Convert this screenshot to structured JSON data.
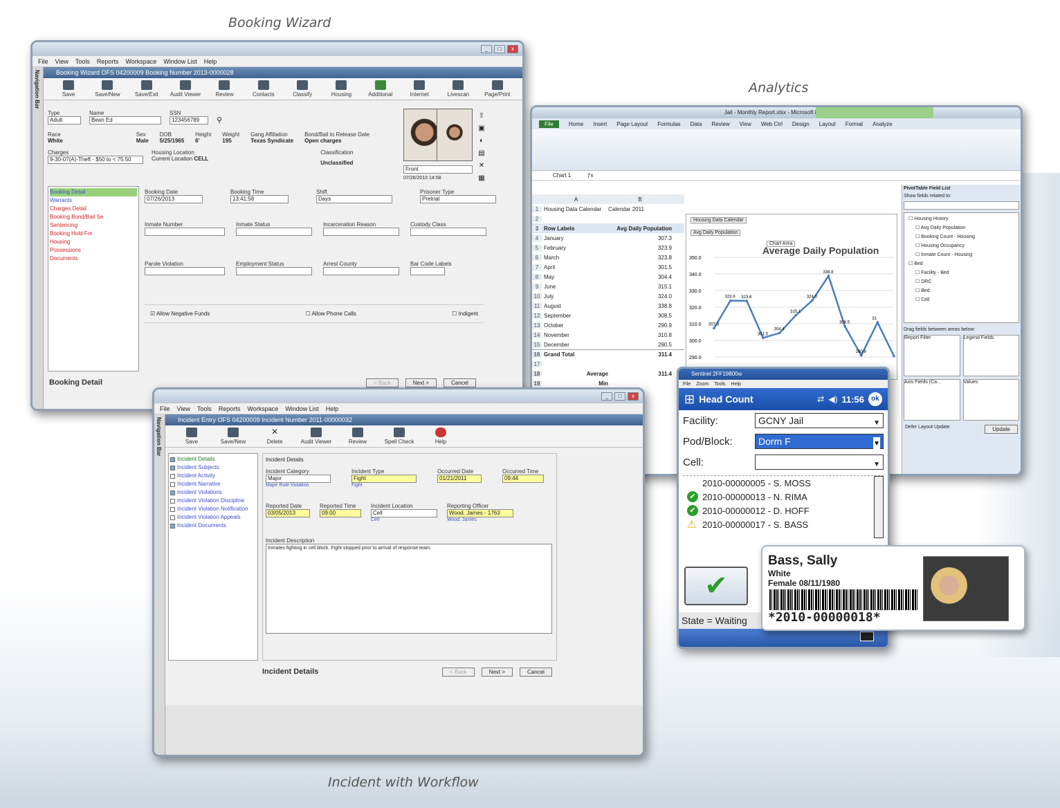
{
  "captions": {
    "booking": "Booking Wizard",
    "analytics": "Analytics",
    "incident": "Incident with Workflow"
  },
  "booking": {
    "menu": [
      "File",
      "View",
      "Tools",
      "Reports",
      "Workspace",
      "Window List",
      "Help"
    ],
    "title": "Booking Wizard   OFS 04200009   Booking Number 2013-0000028",
    "toolbar": [
      "Save",
      "Save/New",
      "Save/Exit",
      "Audit Viewer",
      "Review",
      "Contacts",
      "Classify",
      "Housing",
      "Additional",
      "Internet",
      "Livescan",
      "Page/Print"
    ],
    "labels": {
      "type": "Type",
      "name": "Name",
      "ssn": "SSN",
      "race": "Race",
      "sex": "Sex",
      "dob": "DOB",
      "height": "Height",
      "weight": "Weight",
      "gang": "Gang Affiliation",
      "bond": "Bond/Bail to Release Date",
      "charges": "Charges",
      "housing_location": "Housing Location",
      "current_location": "Current Location",
      "classification": "Classification",
      "booking_date": "Booking Date",
      "booking_time": "Booking Time",
      "shift": "Shift",
      "prisoner_type": "Prisoner Type",
      "inmate_number": "Inmate Number",
      "inmate_status": "Inmate Status",
      "incarceration_reason": "Incarceration Reason",
      "custody_class": "Custody Class",
      "parole_violation": "Parole Violation",
      "employment_status": "Employment Status",
      "arrest_county": "Arrest County",
      "bar_code_labels": "Bar Code Labels"
    },
    "values": {
      "type": "Adult",
      "name": "Bean Ed",
      "ssn": "123456789",
      "race": "White",
      "sex": "Male",
      "dob": "5/25/1965",
      "height": "6'",
      "weight": "195",
      "gang": "Texas Syndicate",
      "bond": "Open charges",
      "charges": "9-30-07(A)-Theft - $50 to < 75.50",
      "current_location": "CELL",
      "classification": "Unclassified",
      "photo_field": "Front",
      "photo_date": "07/26/2013 14:58",
      "booking_date": "07/26/2013",
      "booking_time": "13:41:58",
      "shift": "Days",
      "prisoner_type": "Pretrial"
    },
    "tree": [
      {
        "label": "Booking Detail",
        "color": "#1a7d1a"
      },
      {
        "label": "Warrants",
        "color": "#3b4fc9"
      },
      {
        "label": "Charges Detail",
        "color": "#d02020"
      },
      {
        "label": "Booking Bond/Bail Se",
        "color": "#d02020"
      },
      {
        "label": "Sentencing",
        "color": "#d02020"
      },
      {
        "label": "Booking Hold For",
        "color": "#d02020"
      },
      {
        "label": "Housing",
        "color": "#d02020"
      },
      {
        "label": "Possessions",
        "color": "#d02020"
      },
      {
        "label": "Documents",
        "color": "#d02020"
      }
    ],
    "checks": [
      "Allow Negative Funds",
      "Allow Phone Calls",
      "Indigent"
    ],
    "status": "Booking Detail",
    "buttons": [
      "< Back",
      "Next >",
      "Cancel"
    ]
  },
  "excel": {
    "title": "Jail - Monthly Report.xlsx - Microsoft Excel",
    "tabs": [
      "File",
      "Home",
      "Insert",
      "Page Layout",
      "Formulas",
      "Data",
      "Review",
      "View",
      "Web Ctrl",
      "Design",
      "Layout",
      "Format",
      "Analyze"
    ],
    "name_box": "Chart 1",
    "header_row": [
      "Housing Data Calendar",
      "Calendar 2011"
    ],
    "col_headers": [
      "Row Labels",
      "Avg Daily Population"
    ],
    "rows": [
      {
        "label": "January",
        "value": "307.3"
      },
      {
        "label": "February",
        "value": "323.9"
      },
      {
        "label": "March",
        "value": "323.8"
      },
      {
        "label": "April",
        "value": "301.5"
      },
      {
        "label": "May",
        "value": "304.4"
      },
      {
        "label": "June",
        "value": "315.1"
      },
      {
        "label": "July",
        "value": "324.0"
      },
      {
        "label": "August",
        "value": "338.8"
      },
      {
        "label": "September",
        "value": "308.5"
      },
      {
        "label": "October",
        "value": "290.9"
      },
      {
        "label": "November",
        "value": "310.8"
      },
      {
        "label": "December",
        "value": "290.5"
      },
      {
        "label": "Grand Total",
        "value": "311.4"
      }
    ],
    "summary": [
      {
        "label": "Average",
        "value": "311.4"
      },
      {
        "label": "Min",
        "value": ""
      },
      {
        "label": "Max",
        "value": ""
      }
    ],
    "pane": {
      "title": "PivotTable Field List",
      "choose": "Show fields related to:",
      "fields": [
        "Housing History",
        "Avg Daily Population",
        "Booking Count - Housing",
        "Housing Occupancy",
        "Inmate Count - Housing",
        "Bed",
        "Facility - Bed",
        "DRC",
        "Bed",
        "Cell"
      ],
      "drag": "Drag fields between areas below:",
      "areas": [
        "Report Filter",
        "Legend Fields",
        "Axis Fields (Ca...",
        "Values"
      ],
      "defer": "Defer Layout Update",
      "update": "Update"
    }
  },
  "chart_data": {
    "type": "line",
    "title": "Average Daily Population",
    "categories": [
      "January",
      "February",
      "March",
      "April",
      "May",
      "June",
      "July",
      "August",
      "September",
      "October",
      "November",
      "December"
    ],
    "values": [
      307.3,
      323.9,
      323.8,
      301.5,
      304.4,
      315.1,
      324.0,
      338.8,
      308.5,
      290.9,
      310.8,
      290.5
    ],
    "ylim": [
      280,
      350
    ],
    "yticks": [
      "350.0",
      "340.0",
      "330.0",
      "320.0",
      "310.0",
      "300.0",
      "290.0"
    ],
    "data_labels": [
      "307.3",
      "323.9",
      "323.8",
      "301.5",
      "304.4",
      "315.1",
      "324.0",
      "338.8",
      "308.5",
      "290.9",
      "31"
    ],
    "filter_button": "Housing Data Calendar",
    "series_button": "Avg Daily Population",
    "chart_area_tip": "Chart Area",
    "color": "#4a7eb8"
  },
  "mobile": {
    "title": "Sentinel 2FF19800w",
    "menu": [
      "File",
      "Zoom",
      "Tools",
      "Help"
    ],
    "header": "Head Count",
    "time": "11:56",
    "ok": "ok",
    "fields": [
      {
        "label": "Facility:",
        "value": "GCNY Jail"
      },
      {
        "label": "Pod/Block:",
        "value": "Dorm F"
      },
      {
        "label": "Cell:",
        "value": ""
      }
    ],
    "list": [
      {
        "text": "2010-00000005 - S. MOSS",
        "status": ""
      },
      {
        "text": "2010-00000013 - N. RIMA",
        "status": "ok"
      },
      {
        "text": "2010-00000012 - D. HOFF",
        "status": "ok"
      },
      {
        "text": "2010-00000017 - S. BASS",
        "status": "warn"
      }
    ],
    "state": "State = Waiting"
  },
  "idcard": {
    "name": "Bass, Sally",
    "race": "White",
    "sex_dob": "Female 08/11/1980",
    "barcode": "*2010-00000018*"
  },
  "incident": {
    "menu": [
      "File",
      "View",
      "Tools",
      "Reports",
      "Workspace",
      "Window List",
      "Help"
    ],
    "title": "Incident Entry   OFS 04200009   Incident Number 2011-00000032",
    "toolbar": [
      "Save",
      "Save/New",
      "Delete",
      "Audit Viewer",
      "Review",
      "Spell Check",
      "Help"
    ],
    "tree": [
      {
        "label": "Incident Details",
        "color": "#1a7d1a",
        "checked": true
      },
      {
        "label": "Incident Subjects",
        "color": "#3b4fc9",
        "checked": true
      },
      {
        "label": "Incident Activity",
        "color": "#3b4fc9",
        "checked": false
      },
      {
        "label": "Incident Narrative",
        "color": "#3b4fc9",
        "checked": false
      },
      {
        "label": "Incident Violations",
        "color": "#3b4fc9",
        "checked": true
      },
      {
        "label": "Incident Violation Discipline",
        "color": "#3b4fc9",
        "checked": false
      },
      {
        "label": "Incident Violation Notification",
        "color": "#3b4fc9",
        "checked": false
      },
      {
        "label": "Incident Violation Appeals",
        "color": "#3b4fc9",
        "checked": false
      },
      {
        "label": "Incident Documents",
        "color": "#3b4fc9",
        "checked": true
      }
    ],
    "section": "Incident Details",
    "labels": {
      "category": "Incident Category",
      "type": "Incident Type",
      "occurred_date": "Occurred Date",
      "occurred_time": "Occurred Time",
      "reported_date": "Reported Date",
      "reported_time": "Reported Time",
      "location": "Incident Location",
      "reporting_officer": "Reporting Officer",
      "description": "Incident Description"
    },
    "values": {
      "category": "Major",
      "type": "Fight",
      "occurred_date": "01/21/2011",
      "occurred_time": "09:44",
      "reported_date": "03/05/2013",
      "reported_time": "09:00",
      "location": "Cell",
      "reporting_officer": "Wood, James - 1763",
      "description": "Inmates fighting in cell block. Fight stopped prior to arrival of response team."
    },
    "links": [
      "Major Rule Violation",
      "Fight",
      "Cell",
      "Wood, James"
    ],
    "status": "Incident Details",
    "buttons": [
      "< Back",
      "Next >",
      "Cancel"
    ],
    "navbar": "Navigation Bar"
  }
}
